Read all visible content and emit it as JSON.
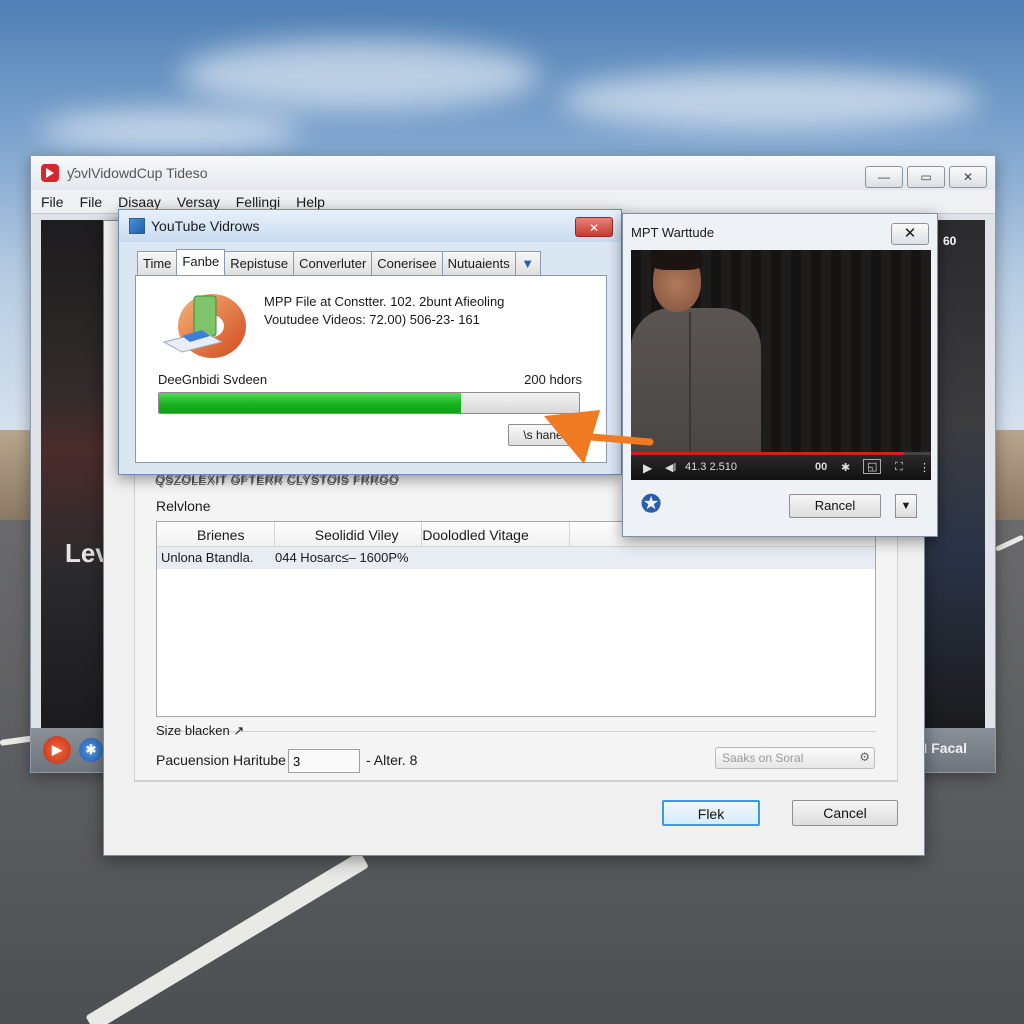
{
  "main_window": {
    "title": "ƴɔvlVidowdCup Tideso",
    "menu": [
      "File",
      "File",
      "Disaay",
      "Versay",
      "Fellingi",
      "Help"
    ],
    "window_buttons": [
      "—",
      "▭",
      "✕"
    ],
    "video_left_text": "Lev",
    "video_right_text": "60",
    "focal_label": "I Facal"
  },
  "settings_dialog": {
    "column_headers": "QSZOLEXIT   GFTERR   CLYSTOIS   FRRGO",
    "section_label": "Relvlone",
    "grid_headers": [
      "Brienes",
      "Seolidid Viley",
      "Doolodled Vitage"
    ],
    "grid_row": {
      "col1": "Unlona Btandla.",
      "col2": "044 Hosarc≤– 1600P%"
    },
    "size_label": "Size blacken ↗",
    "param_label": "Pacuension Haritube",
    "param_value": "3",
    "alter_label": "- Alter. 8",
    "search_placeholder": "Saaks on Soral",
    "ok_label": "Flek",
    "cancel_label": "Cancel"
  },
  "youtube_dialog": {
    "title": "YouTube Vidrows",
    "tabs": [
      "Time",
      "Fanbe",
      "Repistuse",
      "Converluter",
      "Conerisee",
      "Nutuaients"
    ],
    "active_tab_index": 1,
    "info_line1": "MPP File at Constter. 102. 2bunt Afieoling",
    "info_line2": "Voutudee Videos:  72.00) 506-23- 161",
    "status_left": "DeeGnbidi Svdeen",
    "status_right": "200 hdors",
    "progress": 0.72,
    "small_button": "\\s hane"
  },
  "mpt_window": {
    "title": "MPT Warttude",
    "time_readout": "41.3 2.510",
    "seek_progress": 0.91,
    "rancel_label": "Rancel"
  },
  "colors": {
    "progress_green": "#17b21f",
    "accent_orange": "#f07a22",
    "close_red": "#c73a2f",
    "seek_red": "#d81c1c"
  }
}
